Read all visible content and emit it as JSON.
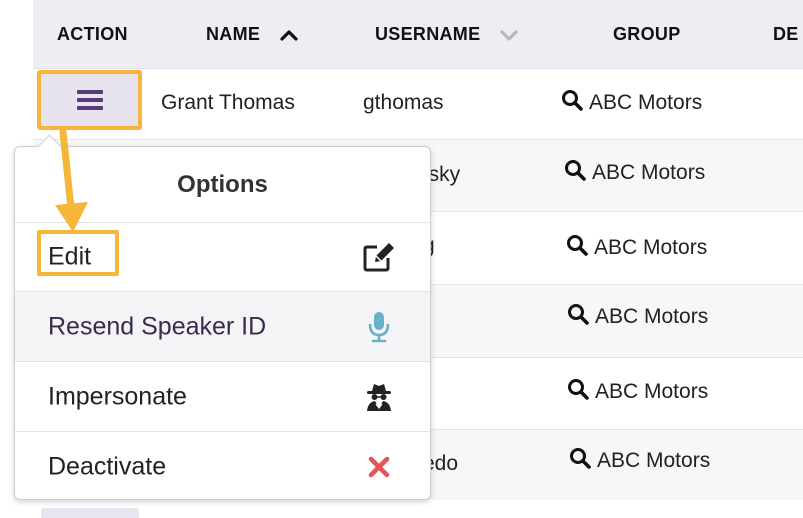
{
  "table": {
    "columns": [
      {
        "key": "action",
        "label": "ACTION"
      },
      {
        "key": "name",
        "label": "NAME",
        "sort": "asc"
      },
      {
        "key": "username",
        "label": "USERNAME",
        "sort": "none"
      },
      {
        "key": "group",
        "label": "GROUP"
      },
      {
        "key": "department_cut",
        "label": "DE"
      }
    ],
    "rows": [
      {
        "name": "Grant Thomas",
        "username": "gthomas",
        "group": "ABC Motors"
      },
      {
        "name": "",
        "username": "nsky",
        "group": "ABC Motors"
      },
      {
        "name": "",
        "username": "g",
        "group": "ABC Motors"
      },
      {
        "name": "",
        "username": "",
        "group": "ABC Motors"
      },
      {
        "name": "",
        "username": "",
        "group": "ABC Motors"
      },
      {
        "name": "",
        "username": "edo",
        "group": "ABC Motors"
      }
    ]
  },
  "menu": {
    "title": "Options",
    "items": [
      {
        "label": "Edit",
        "icon": "edit-icon"
      },
      {
        "label": "Resend Speaker ID",
        "icon": "microphone-icon"
      },
      {
        "label": "Impersonate",
        "icon": "spy-icon"
      },
      {
        "label": "Deactivate",
        "icon": "close-icon"
      }
    ]
  },
  "colors": {
    "highlight": "#f6b63a",
    "header_bg": "#efedf3",
    "action_btn_bg": "#e6e2ee",
    "hamburger": "#5a3a7a",
    "mic": "#6ab0c9",
    "deactivate": "#e05555"
  }
}
